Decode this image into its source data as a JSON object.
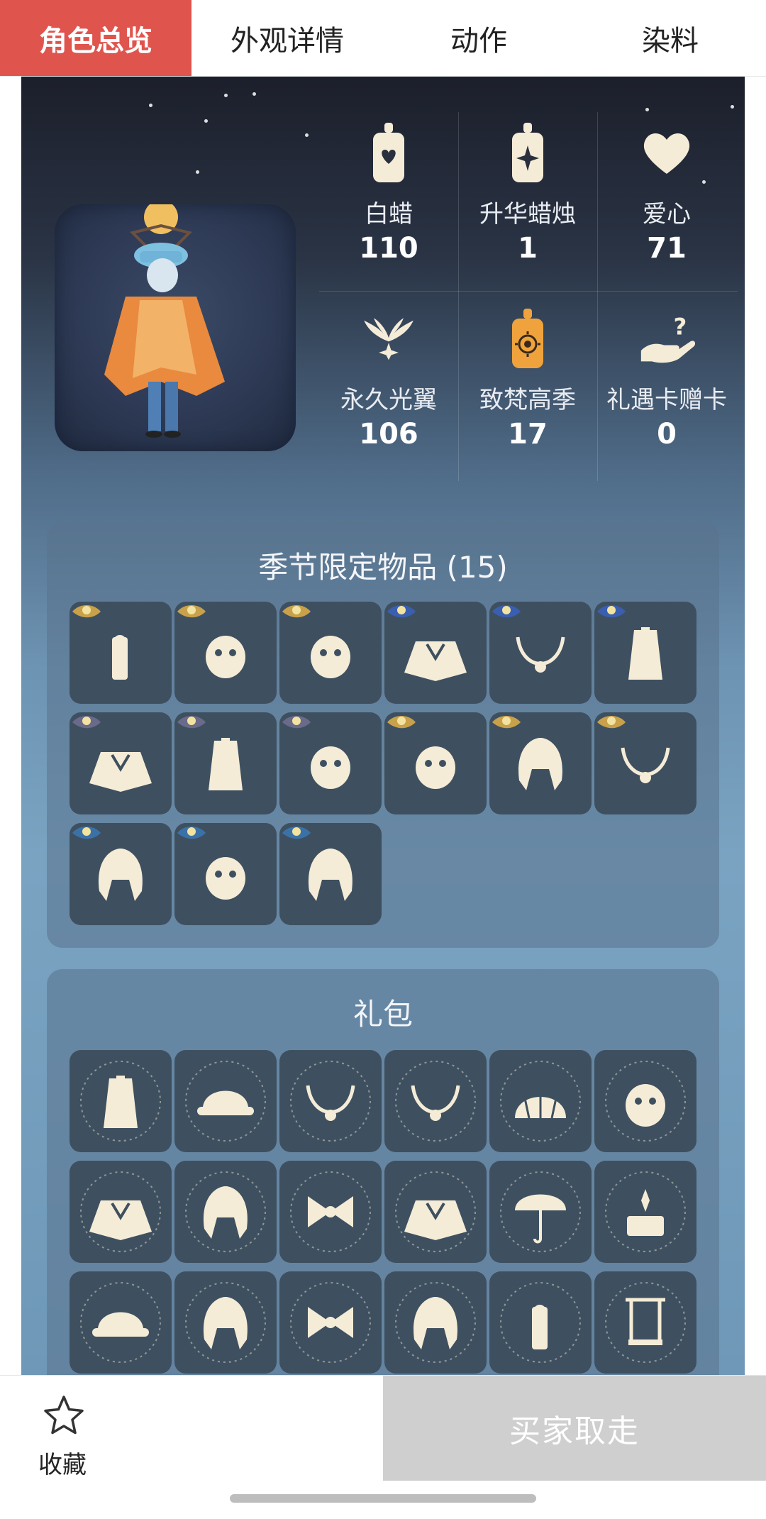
{
  "tabs": [
    {
      "label": "角色总览",
      "active": true
    },
    {
      "label": "外观详情",
      "active": false
    },
    {
      "label": "动作",
      "active": false
    },
    {
      "label": "染料",
      "active": false
    }
  ],
  "stats": [
    {
      "label": "白蜡",
      "value": "110",
      "icon": "white-candle-icon"
    },
    {
      "label": "升华蜡烛",
      "value": "1",
      "icon": "ascended-candle-icon"
    },
    {
      "label": "爱心",
      "value": "71",
      "icon": "heart-icon"
    },
    {
      "label": "永久光翼",
      "value": "106",
      "icon": "winged-light-icon"
    },
    {
      "label": "致梵高季",
      "value": "17",
      "icon": "season-candle-icon"
    },
    {
      "label": "礼遇卡赠卡",
      "value": "0",
      "icon": "gift-card-hand-icon"
    }
  ],
  "seasonal": {
    "title": "季节限定物品 (15)",
    "items": [
      "hair-accessory-icon",
      "mask-icon",
      "mask-icon",
      "cape-icon",
      "necklace-icon",
      "outfit-icon",
      "cape-icon",
      "outfit-icon",
      "mask-icon",
      "mask-icon",
      "hair-icon",
      "necklace-icon",
      "hair-icon",
      "mask-icon",
      "hair-icon"
    ]
  },
  "gift": {
    "title": "礼包",
    "items": [
      "outfit-icon",
      "hat-icon",
      "necklace-icon",
      "necklace-icon",
      "shell-icon",
      "mask-icon",
      "cape-icon",
      "hair-icon",
      "bow-icon",
      "cape-icon",
      "umbrella-icon",
      "prop-icon",
      "hat-icon",
      "hair-icon",
      "bow-icon",
      "hair-icon",
      "hair-accessory-icon",
      "swing-icon"
    ]
  },
  "bottom": {
    "fav_label": "收藏",
    "buyer_label": "买家取走"
  },
  "colors": {
    "accent": "#e0544e",
    "cell_bg": "#3e5060",
    "icon_cream": "#f5ecd7"
  }
}
